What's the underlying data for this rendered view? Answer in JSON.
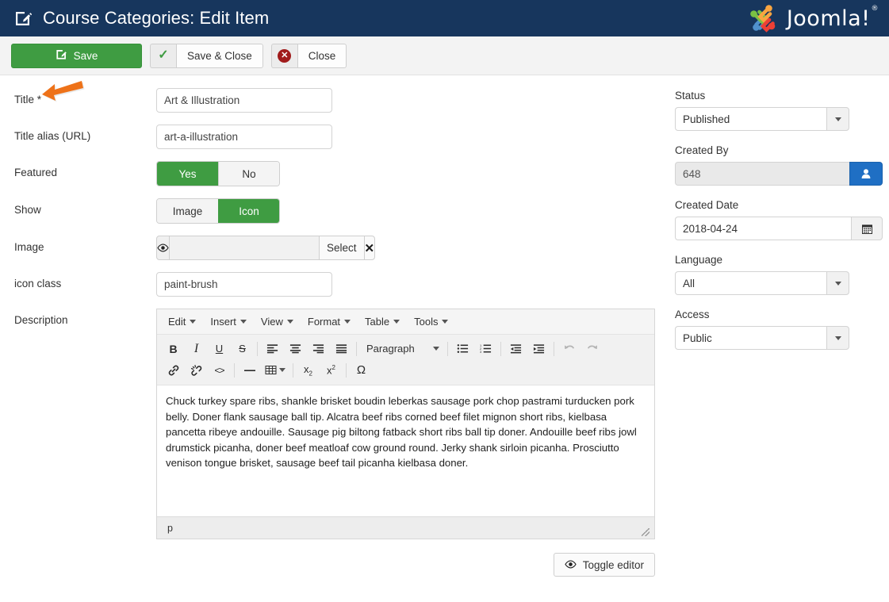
{
  "header": {
    "title": "Course Categories: Edit Item",
    "edit_icon": "edit-document-icon",
    "brand_name": "Joomla!",
    "brand_reg": "®",
    "brand_icon": "joomla-logo-icon",
    "bg_color": "#17365d"
  },
  "toolbar": {
    "save_label": "Save",
    "save_icon": "save-pencil-icon",
    "save_color": "#3f9c42",
    "save_close_label": "Save & Close",
    "save_close_icon": "check-icon",
    "close_label": "Close",
    "close_icon": "close-circle-icon",
    "close_icon_color": "#a01b1b"
  },
  "form": {
    "title": {
      "label": "Title *",
      "value": "Art & Illustration",
      "placeholder": ""
    },
    "alias": {
      "label": "Title alias (URL)",
      "value": "art-a-illustration",
      "placeholder": ""
    },
    "featured": {
      "label": "Featured",
      "options": [
        "Yes",
        "No"
      ],
      "selected": "Yes",
      "active_color": "#3f9c42"
    },
    "show": {
      "label": "Show",
      "options": [
        "Image",
        "Icon"
      ],
      "selected": "Icon",
      "active_color": "#3f9c42"
    },
    "image": {
      "label": "Image",
      "value": "",
      "placeholder": "",
      "preview_icon": "eye-icon",
      "select_label": "Select",
      "clear_icon": "clear-x-icon"
    },
    "icon_class": {
      "label": "icon class",
      "value": "paint-brush",
      "placeholder": ""
    },
    "description": {
      "label": "Description"
    }
  },
  "editor": {
    "menus": [
      {
        "label": "Edit",
        "icon": "chevron-down-icon"
      },
      {
        "label": "Insert",
        "icon": "chevron-down-icon"
      },
      {
        "label": "View",
        "icon": "chevron-down-icon"
      },
      {
        "label": "Format",
        "icon": "chevron-down-icon"
      },
      {
        "label": "Table",
        "icon": "chevron-down-icon"
      },
      {
        "label": "Tools",
        "icon": "chevron-down-icon"
      }
    ],
    "format_select": {
      "value": "Paragraph",
      "icon": "chevron-down-icon"
    },
    "toolbar_row1": [
      {
        "name": "bold-icon",
        "glyph": "B",
        "style": "bold",
        "disabled": false
      },
      {
        "name": "italic-icon",
        "glyph": "I",
        "style": "italic-serif",
        "disabled": false
      },
      {
        "name": "underline-icon",
        "glyph": "U",
        "style": "underline",
        "disabled": false
      },
      {
        "name": "strikethrough-icon",
        "glyph": "S",
        "style": "strike",
        "disabled": false
      }
    ],
    "toolbar_row2": [
      {
        "name": "link-icon",
        "disabled": false
      },
      {
        "name": "unlink-icon",
        "disabled": false
      },
      {
        "name": "source-code-icon",
        "glyph": "<>",
        "disabled": false
      },
      {
        "name": "horizontal-rule-icon",
        "glyph": "—",
        "disabled": false
      },
      {
        "name": "table-icon",
        "disabled": false
      },
      {
        "name": "subscript-icon",
        "disabled": false
      },
      {
        "name": "superscript-icon",
        "disabled": false
      },
      {
        "name": "special-character-icon",
        "glyph": "Ω",
        "disabled": false
      }
    ],
    "align_icons": [
      "align-left-icon",
      "align-center-icon",
      "align-right-icon",
      "align-justify-icon"
    ],
    "list_icons": [
      "bullet-list-icon",
      "numbered-list-icon"
    ],
    "indent_icons": [
      "outdent-icon",
      "indent-icon"
    ],
    "history_icons": [
      "undo-icon",
      "redo-icon"
    ],
    "body_text": "Chuck turkey spare ribs, shankle brisket boudin leberkas sausage pork chop pastrami turducken pork belly. Doner flank sausage ball tip. Alcatra beef ribs corned beef filet mignon short ribs, kielbasa pancetta ribeye andouille. Sausage pig biltong fatback short ribs ball tip doner. Andouille beef ribs jowl drumstick picanha, doner beef meatloaf cow ground round. Jerky shank sirloin picanha. Prosciutto venison tongue brisket, sausage beef tail picanha kielbasa doner.",
    "status_path": "p",
    "resize_handle": "resize-grip-icon",
    "toggle_label": "Toggle editor",
    "toggle_icon": "eye-icon"
  },
  "sidebar": {
    "status": {
      "label": "Status",
      "value": "Published",
      "icon": "chevron-down-icon"
    },
    "created_by": {
      "label": "Created By",
      "value": "648",
      "button_icon": "user-icon",
      "button_color": "#1f6fc4"
    },
    "created_date": {
      "label": "Created Date",
      "value": "2018-04-24",
      "button_icon": "calendar-icon"
    },
    "language": {
      "label": "Language",
      "value": "All",
      "icon": "chevron-down-icon"
    },
    "access": {
      "label": "Access",
      "value": "Public",
      "icon": "chevron-down-icon"
    }
  },
  "annotation": {
    "arrow_icon": "orange-pointer-arrow-icon",
    "color": "#ee7219"
  }
}
